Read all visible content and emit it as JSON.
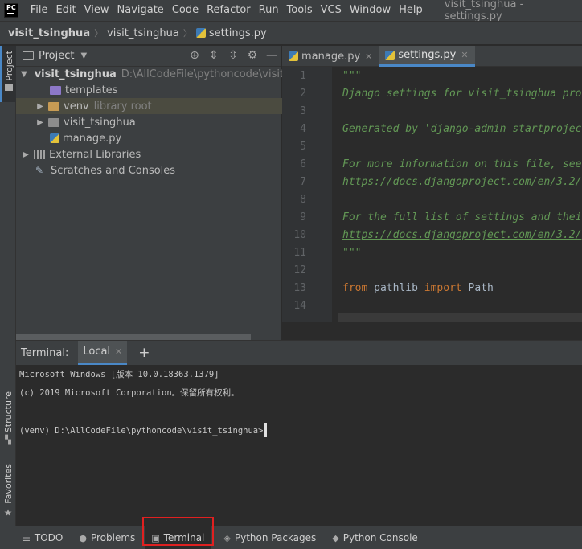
{
  "menubar": {
    "logo_text": "PC",
    "items": [
      "File",
      "Edit",
      "View",
      "Navigate",
      "Code",
      "Refactor",
      "Run",
      "Tools",
      "VCS",
      "Window",
      "Help"
    ],
    "window_title": "visit_tsinghua - settings.py"
  },
  "breadcrumb": {
    "items": [
      "visit_tsinghua",
      "visit_tsinghua",
      "settings.py"
    ]
  },
  "left_strip": {
    "project": "Project",
    "structure": "Structure",
    "favorites": "Favorites"
  },
  "project_panel": {
    "title": "Project",
    "tree": [
      {
        "label": "visit_tsinghua",
        "hint": "D:\\AllCodeFile\\pythoncode\\visit_ts"
      },
      {
        "label": "templates",
        "hint": ""
      },
      {
        "label": "venv",
        "hint": "library root"
      },
      {
        "label": "visit_tsinghua",
        "hint": ""
      },
      {
        "label": "manage.py",
        "hint": ""
      },
      {
        "label": "External Libraries",
        "hint": ""
      },
      {
        "label": "Scratches and Consoles",
        "hint": ""
      }
    ]
  },
  "editor": {
    "tabs": [
      {
        "label": "manage.py"
      },
      {
        "label": "settings.py"
      }
    ],
    "lines": [
      {
        "n": "1",
        "text": "\"\"\""
      },
      {
        "n": "2",
        "text": "Django settings for visit_tsinghua pro"
      },
      {
        "n": "3",
        "text": ""
      },
      {
        "n": "4",
        "text": "Generated by 'django-admin startprojec"
      },
      {
        "n": "5",
        "text": ""
      },
      {
        "n": "6",
        "text": "For more information on this file, see"
      },
      {
        "n": "7",
        "text": "https://docs.djangoproject.com/en/3.2/"
      },
      {
        "n": "8",
        "text": ""
      },
      {
        "n": "9",
        "text": "For the full list of settings and their"
      },
      {
        "n": "10",
        "text": "https://docs.djangoproject.com/en/3.2/"
      },
      {
        "n": "11",
        "text": "\"\"\""
      },
      {
        "n": "12",
        "text": ""
      },
      {
        "n": "13",
        "kw1": "from",
        "mid": " pathlib ",
        "kw2": "import",
        "end": " Path"
      },
      {
        "n": "14",
        "text": ""
      }
    ]
  },
  "terminal": {
    "label": "Terminal:",
    "tab": "Local",
    "lines": [
      "Microsoft Windows [版本 10.0.18363.1379]",
      "(c) 2019 Microsoft Corporation。保留所有权利。",
      "",
      "(venv) D:\\AllCodeFile\\pythoncode\\visit_tsinghua>"
    ]
  },
  "bottombar": {
    "items": [
      "TODO",
      "Problems",
      "Terminal",
      "Python Packages",
      "Python Console"
    ]
  }
}
